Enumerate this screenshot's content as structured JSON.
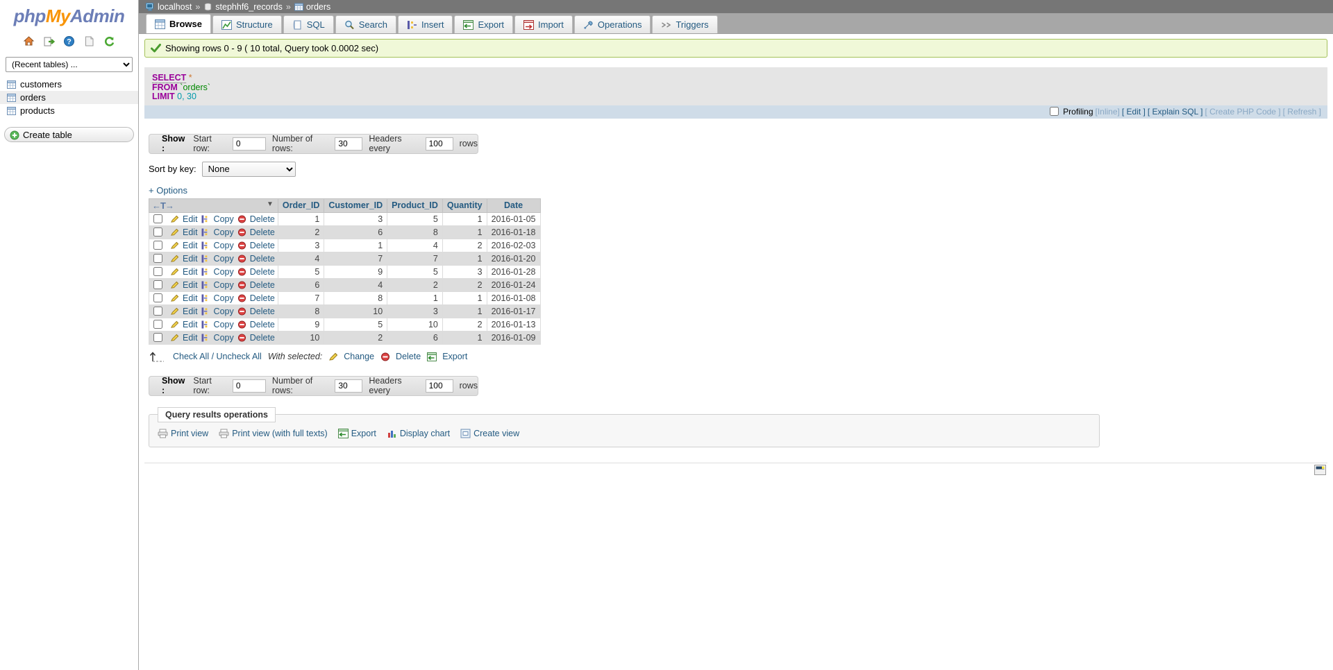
{
  "app": {
    "logo_php": "php",
    "logo_my": "My",
    "logo_admin": "Admin"
  },
  "sidebar": {
    "icons": [
      {
        "name": "home-icon",
        "title": "Home"
      },
      {
        "name": "logout-icon",
        "title": "Log out"
      },
      {
        "name": "help-icon",
        "title": "Documentation"
      },
      {
        "name": "docs-icon",
        "title": "phpMyAdmin documentation"
      },
      {
        "name": "reload-icon",
        "title": "Reload navigation"
      }
    ],
    "recent_select": {
      "value": "(Recent tables) ...",
      "options": [
        "(Recent tables) ..."
      ]
    },
    "tables": [
      {
        "label": "customers",
        "selected": false
      },
      {
        "label": "orders",
        "selected": true
      },
      {
        "label": "products",
        "selected": false
      }
    ],
    "create_table_label": "Create table"
  },
  "breadcrumb": {
    "server": "localhost",
    "database": "stephhf6_records",
    "table": "orders",
    "separator": "»"
  },
  "tabs": [
    {
      "label": "Browse",
      "icon": "browse-icon",
      "active": true
    },
    {
      "label": "Structure",
      "icon": "structure-icon",
      "active": false
    },
    {
      "label": "SQL",
      "icon": "sql-icon",
      "active": false
    },
    {
      "label": "Search",
      "icon": "search-icon",
      "active": false
    },
    {
      "label": "Insert",
      "icon": "insert-icon",
      "active": false
    },
    {
      "label": "Export",
      "icon": "export-icon",
      "active": false
    },
    {
      "label": "Import",
      "icon": "import-icon",
      "active": false
    },
    {
      "label": "Operations",
      "icon": "operations-icon",
      "active": false
    },
    {
      "label": "Triggers",
      "icon": "triggers-icon",
      "active": false
    }
  ],
  "notice": {
    "text": "Showing rows 0 - 9 ( 10 total, Query took 0.0002 sec)"
  },
  "sql": {
    "line1_kw": "SELECT",
    "line1_star": "*",
    "line2_kw": "FROM",
    "line2_ident": "`orders`",
    "line3_kw": "LIMIT",
    "line3_a": "0",
    "line3_comma": ",",
    "line3_b": "30"
  },
  "sql_footer": {
    "profiling_label": "Profiling",
    "inline": "[Inline]",
    "edit": "[ Edit ]",
    "explain": "[ Explain SQL ]",
    "create_php": "[ Create PHP Code ]",
    "refresh": "[ Refresh ]"
  },
  "show_bar": {
    "label": "Show :",
    "start_row_label": "Start row:",
    "start_row_value": "0",
    "num_rows_label": "Number of rows:",
    "num_rows_value": "30",
    "headers_label": "Headers every",
    "headers_value": "100",
    "rows_suffix": "rows"
  },
  "sort": {
    "label": "Sort by key:",
    "value": "None",
    "options": [
      "None"
    ]
  },
  "options_link": "+ Options",
  "table": {
    "action_header_arrows": "←T→",
    "columns": [
      "Order_ID",
      "Customer_ID",
      "Product_ID",
      "Quantity",
      "Date"
    ],
    "row_actions": {
      "edit": "Edit",
      "copy": "Copy",
      "delete": "Delete"
    },
    "rows": [
      {
        "Order_ID": "1",
        "Customer_ID": "3",
        "Product_ID": "5",
        "Quantity": "1",
        "Date": "2016-01-05"
      },
      {
        "Order_ID": "2",
        "Customer_ID": "6",
        "Product_ID": "8",
        "Quantity": "1",
        "Date": "2016-01-18"
      },
      {
        "Order_ID": "3",
        "Customer_ID": "1",
        "Product_ID": "4",
        "Quantity": "2",
        "Date": "2016-02-03"
      },
      {
        "Order_ID": "4",
        "Customer_ID": "7",
        "Product_ID": "7",
        "Quantity": "1",
        "Date": "2016-01-20"
      },
      {
        "Order_ID": "5",
        "Customer_ID": "9",
        "Product_ID": "5",
        "Quantity": "3",
        "Date": "2016-01-28"
      },
      {
        "Order_ID": "6",
        "Customer_ID": "4",
        "Product_ID": "2",
        "Quantity": "2",
        "Date": "2016-01-24"
      },
      {
        "Order_ID": "7",
        "Customer_ID": "8",
        "Product_ID": "1",
        "Quantity": "1",
        "Date": "2016-01-08"
      },
      {
        "Order_ID": "8",
        "Customer_ID": "10",
        "Product_ID": "3",
        "Quantity": "1",
        "Date": "2016-01-17"
      },
      {
        "Order_ID": "9",
        "Customer_ID": "5",
        "Product_ID": "10",
        "Quantity": "2",
        "Date": "2016-01-13"
      },
      {
        "Order_ID": "10",
        "Customer_ID": "2",
        "Product_ID": "6",
        "Quantity": "1",
        "Date": "2016-01-09"
      }
    ]
  },
  "check_all": {
    "check_all_label": "Check All / Uncheck All",
    "with_selected": "With selected:",
    "change": "Change",
    "delete": "Delete",
    "export": "Export"
  },
  "query_results_operations": {
    "legend": "Query results operations",
    "links": [
      {
        "label": "Print view",
        "icon": "print-icon"
      },
      {
        "label": "Print view (with full texts)",
        "icon": "print-full-icon"
      },
      {
        "label": "Export",
        "icon": "export-icon"
      },
      {
        "label": "Display chart",
        "icon": "chart-icon"
      },
      {
        "label": "Create view",
        "icon": "create-view-icon"
      }
    ]
  },
  "colors": {
    "accent_link": "#235a81",
    "notice_bg": "#f0f8d8",
    "notice_border": "#a3c159",
    "breadcrumb_bg": "#767676",
    "tabbar_bg": "#a7a7a7",
    "sql_bg": "#e5e5e5",
    "sql_footer_bg": "#cfdce8",
    "header_bg": "#d3d3d3",
    "row_even_bg": "#dddddd",
    "logo_orange": "#f89406",
    "logo_blue": "#6c7eb7"
  }
}
